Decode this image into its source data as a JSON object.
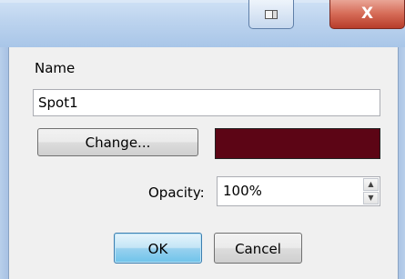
{
  "titlebar": {
    "close_label": "X"
  },
  "form": {
    "name_label": "Name",
    "name_value": "Spot1",
    "change_label": "Change...",
    "color": "#5c0515",
    "opacity_label": "Opacity:",
    "opacity_value": "100%",
    "spin_up": "▲",
    "spin_down": "▼"
  },
  "buttons": {
    "ok_label": "OK",
    "cancel_label": "Cancel"
  }
}
